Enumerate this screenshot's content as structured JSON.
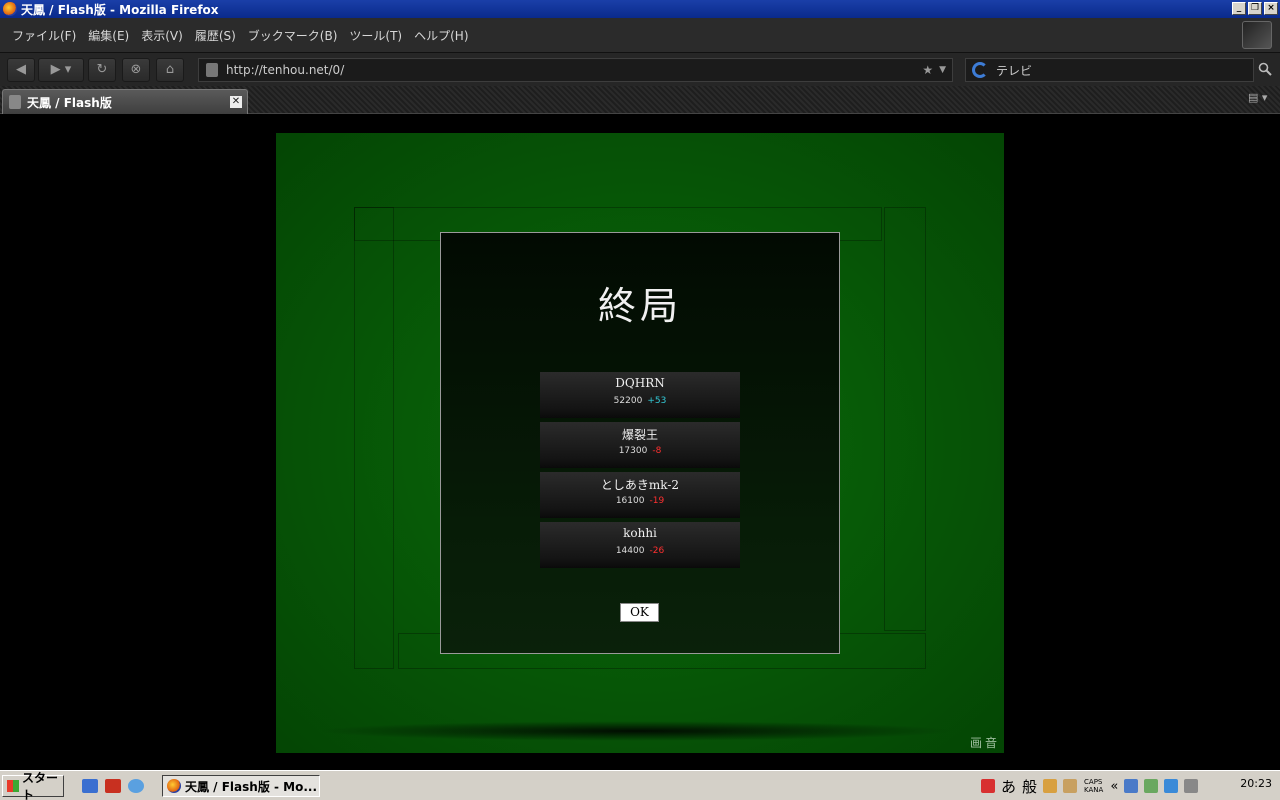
{
  "window": {
    "title": "天鳳 / Flash版 - Mozilla Firefox"
  },
  "menu": [
    "ファイル(F)",
    "編集(E)",
    "表示(V)",
    "履歴(S)",
    "ブックマーク(B)",
    "ツール(T)",
    "ヘルプ(H)"
  ],
  "nav": {
    "url": "http://tenhou.net/0/",
    "search_text": "テレビ"
  },
  "tab": {
    "title": "天鳳 / Flash版"
  },
  "game": {
    "dialog_title": "終局",
    "players": [
      {
        "name": "DQHRN",
        "score": "52200",
        "delta": "+53"
      },
      {
        "name": "爆裂王",
        "score": "17300",
        "delta": "-8"
      },
      {
        "name": "としあきmk-2",
        "score": "16100",
        "delta": "-19"
      },
      {
        "name": "kohhi",
        "score": "14400",
        "delta": "-26"
      }
    ],
    "ok_label": "OK",
    "corner_text": "画音"
  },
  "taskbar": {
    "start_label": "スタート",
    "task_label": "天鳳 / Flash版 - Mo...",
    "ime_a": "あ",
    "ime_mode": "般",
    "caps": "CAPS",
    "kana": "KANA",
    "chevron": "«",
    "clock": "20:23"
  },
  "colors": {
    "table_green": "#075a07",
    "delta_plus": "#33c9d6",
    "delta_minus": "#ff3030"
  }
}
